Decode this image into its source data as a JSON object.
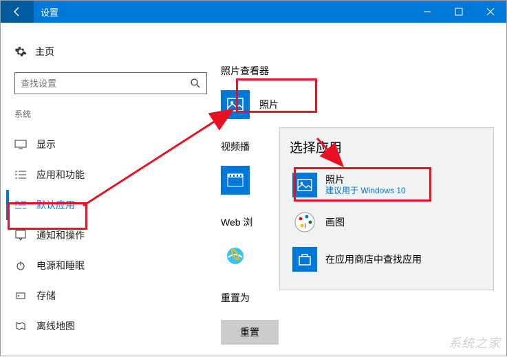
{
  "titlebar": {
    "title": "设置"
  },
  "sidebar": {
    "home": "主页",
    "search_placeholder": "查找设置",
    "group": "系统",
    "items": [
      {
        "label": "显示"
      },
      {
        "label": "应用和功能"
      },
      {
        "label": "默认应用"
      },
      {
        "label": "通知和操作"
      },
      {
        "label": "电源和睡眠"
      },
      {
        "label": "存储"
      },
      {
        "label": "离线地图"
      }
    ]
  },
  "main": {
    "section_photo_viewer": "照片查看器",
    "photo_app": "照片",
    "section_video": "视频播",
    "section_web": "Web 浏",
    "reset_label": "重置为",
    "reset_button": "重置"
  },
  "popup": {
    "title": "选择应用",
    "items": [
      {
        "label": "照片",
        "sub": "建议用于 Windows 10"
      },
      {
        "label": "画图"
      },
      {
        "label": "在应用商店中查找应用"
      }
    ]
  },
  "watermark": "系统之家"
}
